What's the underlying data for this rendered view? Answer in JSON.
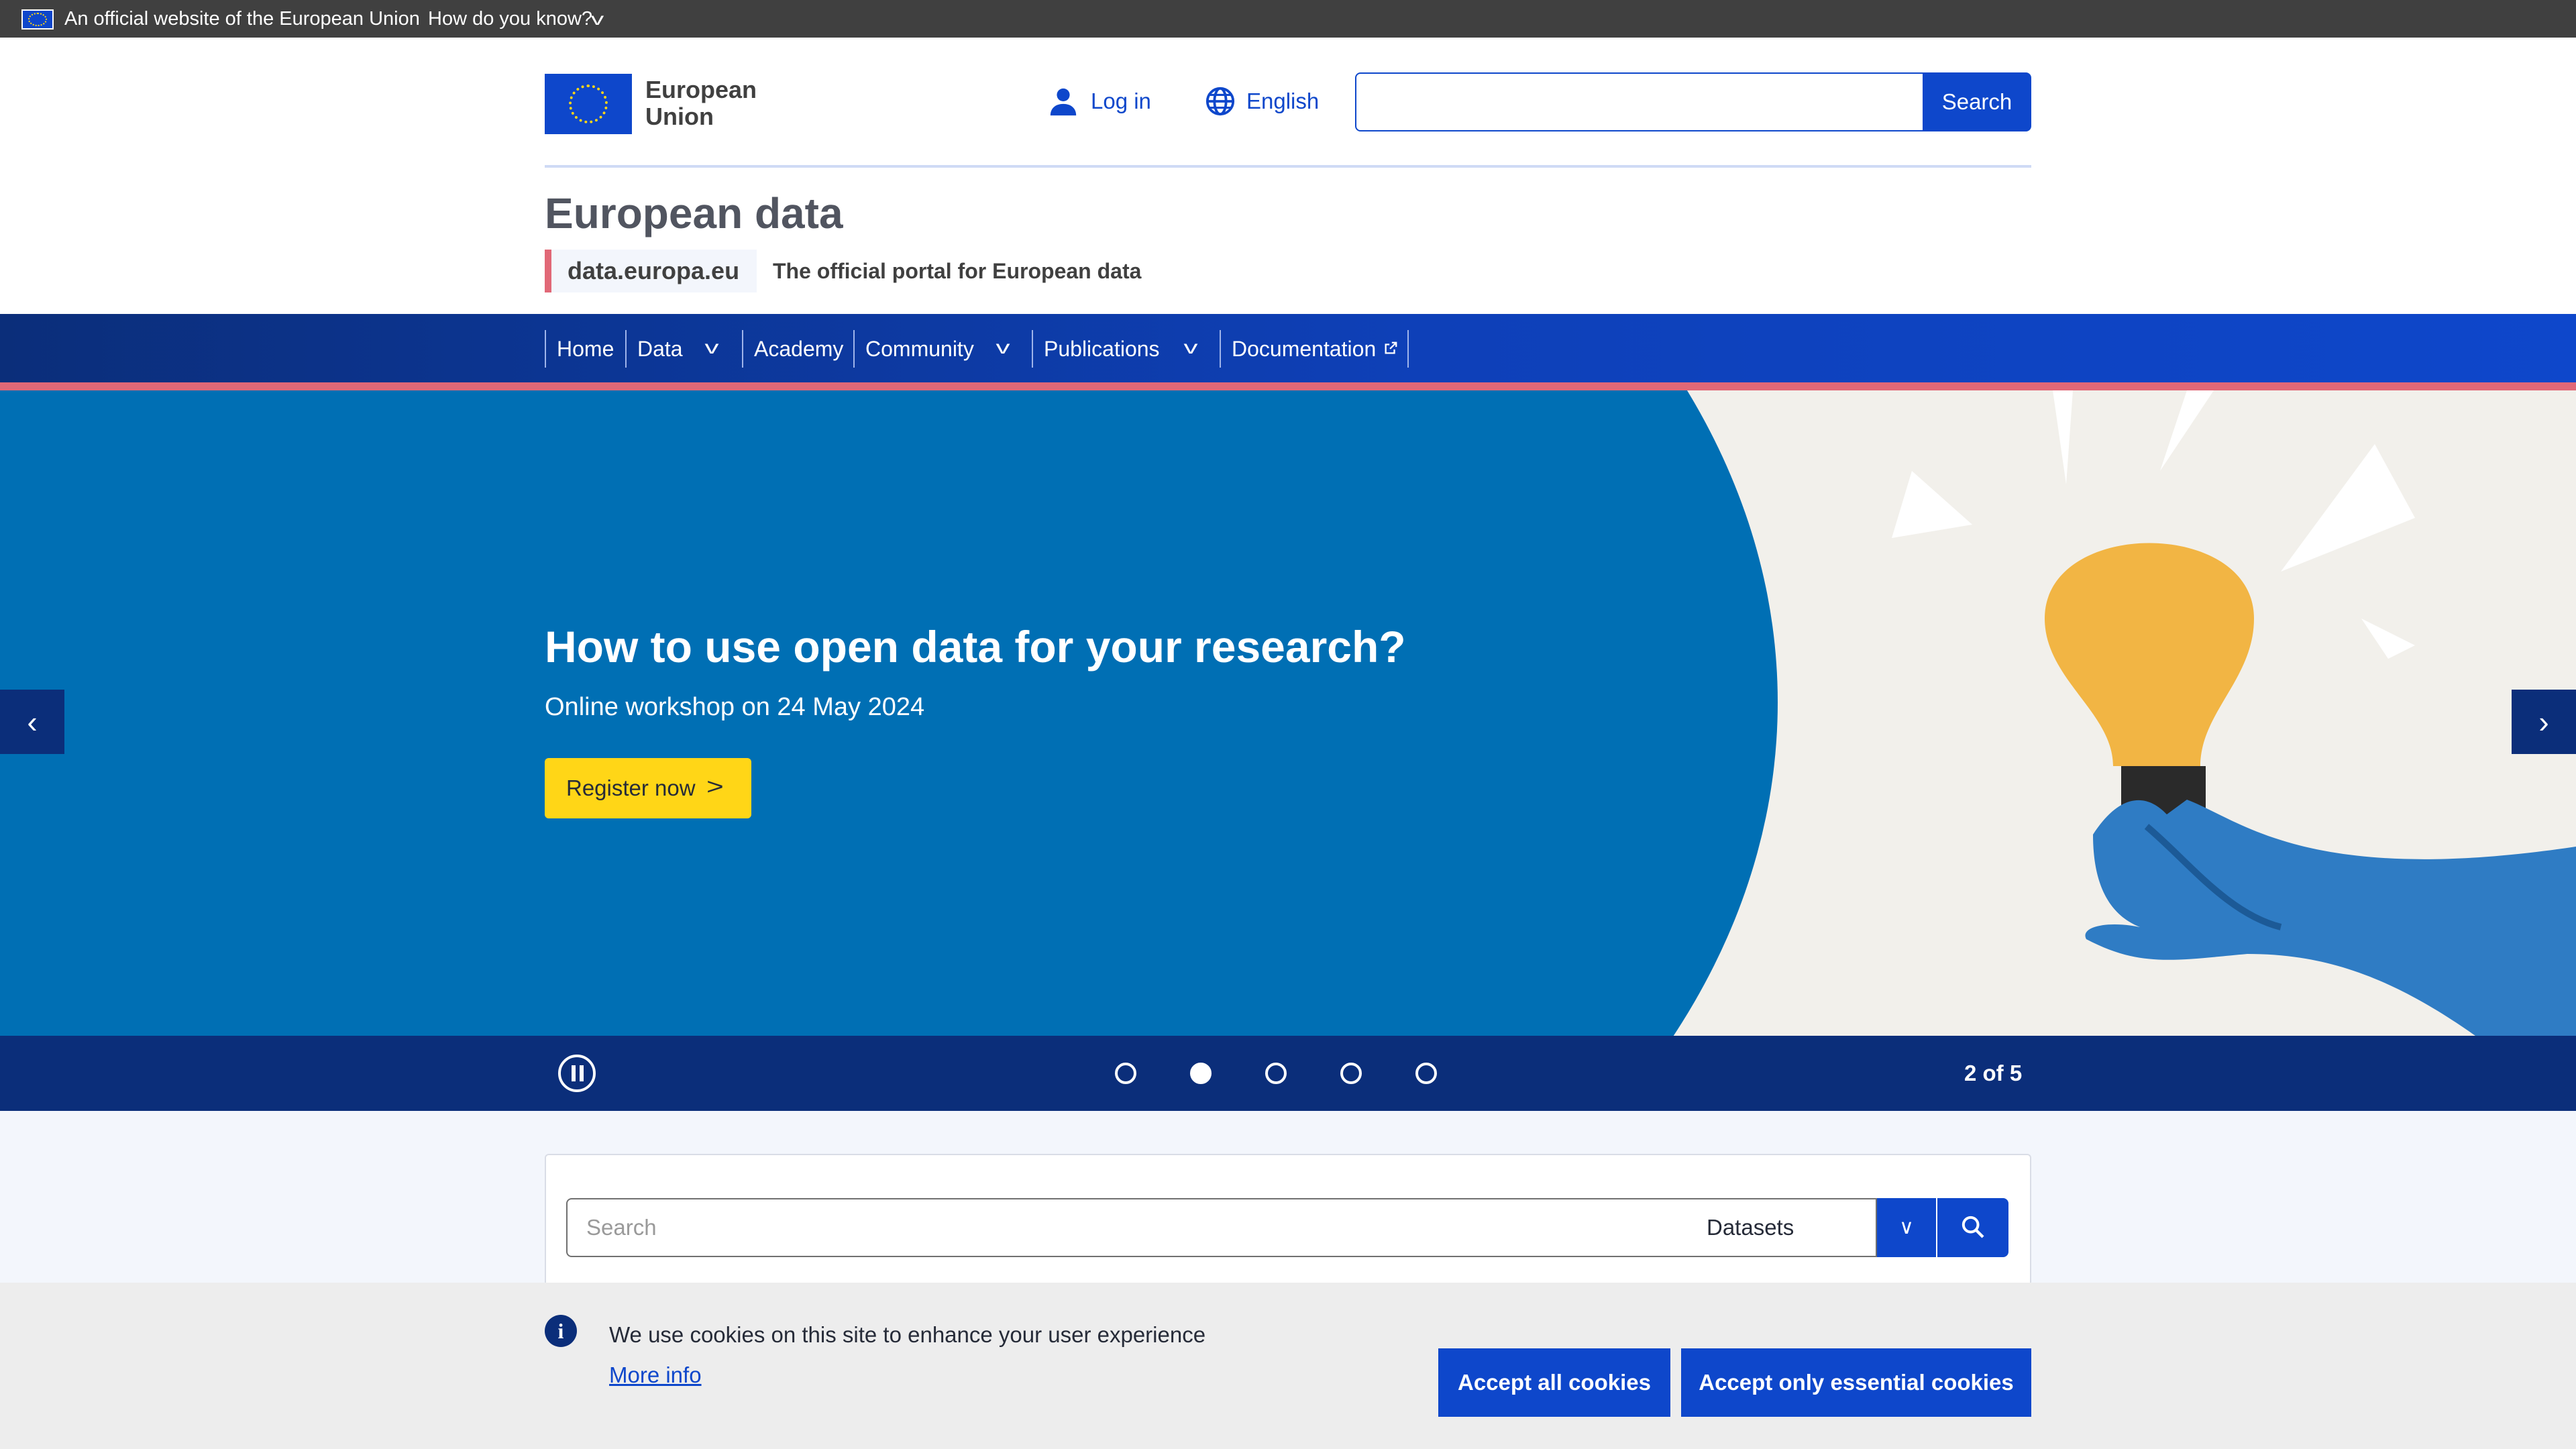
{
  "eu_bar": {
    "official_text": "An official website of the European Union",
    "how_text": "How do you know?"
  },
  "header": {
    "logo_text_line1": "European",
    "logo_text_line2": "Union",
    "login_label": "Log in",
    "language_label": "English",
    "search_value": "",
    "search_button": "Search"
  },
  "site": {
    "title": "European data",
    "tag": "data.europa.eu",
    "subtitle": "The official portal for European data"
  },
  "nav": {
    "items": [
      {
        "label": "Home",
        "has_dropdown": false
      },
      {
        "label": "Data",
        "has_dropdown": true
      },
      {
        "label": "Academy",
        "has_dropdown": false
      },
      {
        "label": "Community",
        "has_dropdown": true
      },
      {
        "label": "Publications",
        "has_dropdown": true
      },
      {
        "label": "Documentation",
        "has_dropdown": false,
        "external": true
      }
    ]
  },
  "hero": {
    "title": "How to use open data for your research?",
    "subtitle": "Online workshop on 24 May 2024",
    "cta": "Register now",
    "slide_counter": "2 of 5",
    "current_slide": 2,
    "total_slides": 5
  },
  "dataset_search": {
    "placeholder": "Search",
    "value": "",
    "type_selected": "Datasets"
  },
  "cookie": {
    "text": "We use cookies on this site to enhance your user experience",
    "more_info": "More info",
    "accept_all": "Accept all cookies",
    "accept_essential": "Accept only essential cookies"
  },
  "colors": {
    "eu_blue": "#0e47cb",
    "navy": "#0b2e7a",
    "hero_blue": "#006fb4",
    "accent_pink": "#e16877",
    "cta_yellow": "#ffd617"
  },
  "icons": [
    "eu-flag-icon",
    "chevron-down-icon",
    "user-icon",
    "globe-icon",
    "chevron-right-icon",
    "chevron-left-icon",
    "pause-icon",
    "search-icon",
    "info-icon",
    "external-link-icon"
  ]
}
